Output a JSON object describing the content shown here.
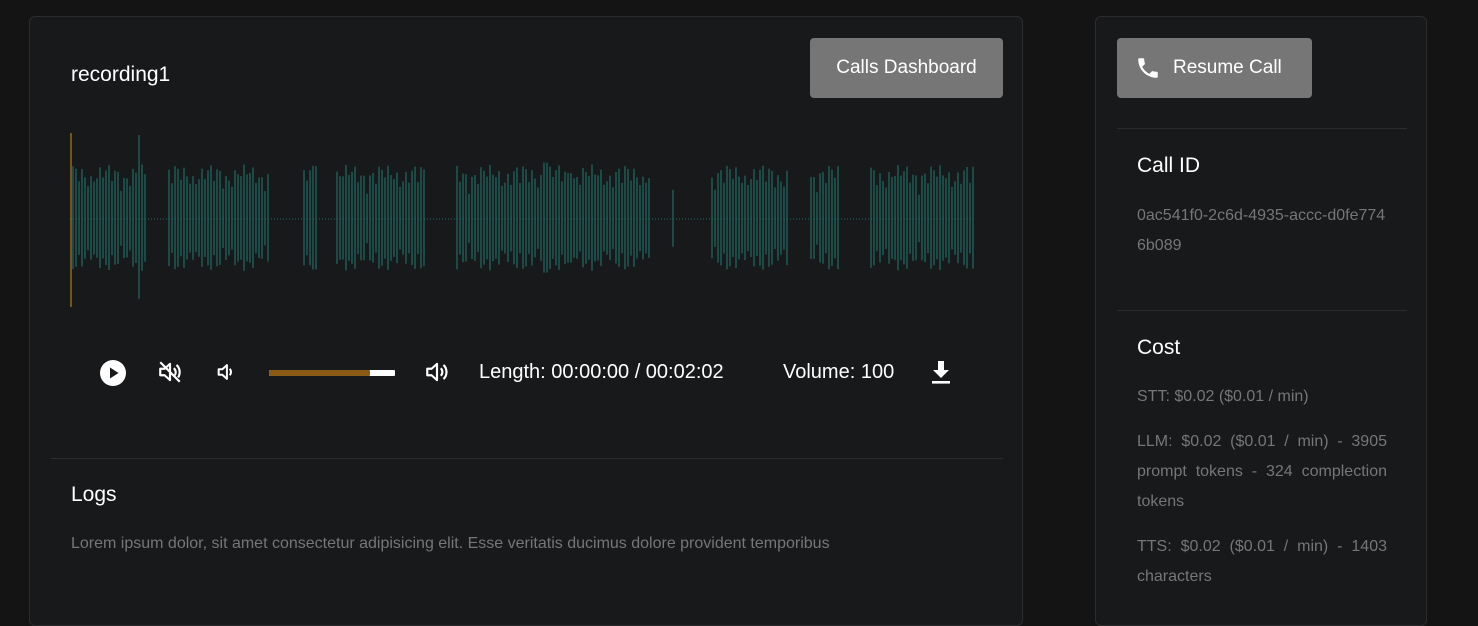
{
  "recording": {
    "title": "recording1",
    "dashboard_label": "Calls Dashboard"
  },
  "player": {
    "length_text": "Length: 00:00:00 / 00:02:02",
    "volume_text": "Volume: 100",
    "volume_level_percent": 80,
    "progress_fraction": 0,
    "icons": [
      "play-icon",
      "muted-icon",
      "volume-down-icon",
      "volume-up-icon",
      "download-icon"
    ]
  },
  "logs": {
    "title": "Logs",
    "text": "Lorem ipsum dolor, sit amet consectetur adipisicing elit. Esse veritatis ducimus dolore provident temporibus"
  },
  "side": {
    "resume_label": "Resume Call",
    "call_id_title": "Call ID",
    "call_id_value": "0ac541f0-2c6d-4935-accc-d0fe7746b089",
    "cost_title": "Cost",
    "stt": "STT: $0.02 ($0.01 / min)",
    "llm": "LLM: $0.02 ($0.01 / min) - 3905 prompt tokens - 324 complection tokens",
    "tts": "TTS: $0.02 ($0.01 / min) - 1403 characters"
  },
  "colors": {
    "waveform": "#1f6b63",
    "cursor": "#b97a1e",
    "slider_fill": "#8a5a16",
    "button": "#767676"
  }
}
